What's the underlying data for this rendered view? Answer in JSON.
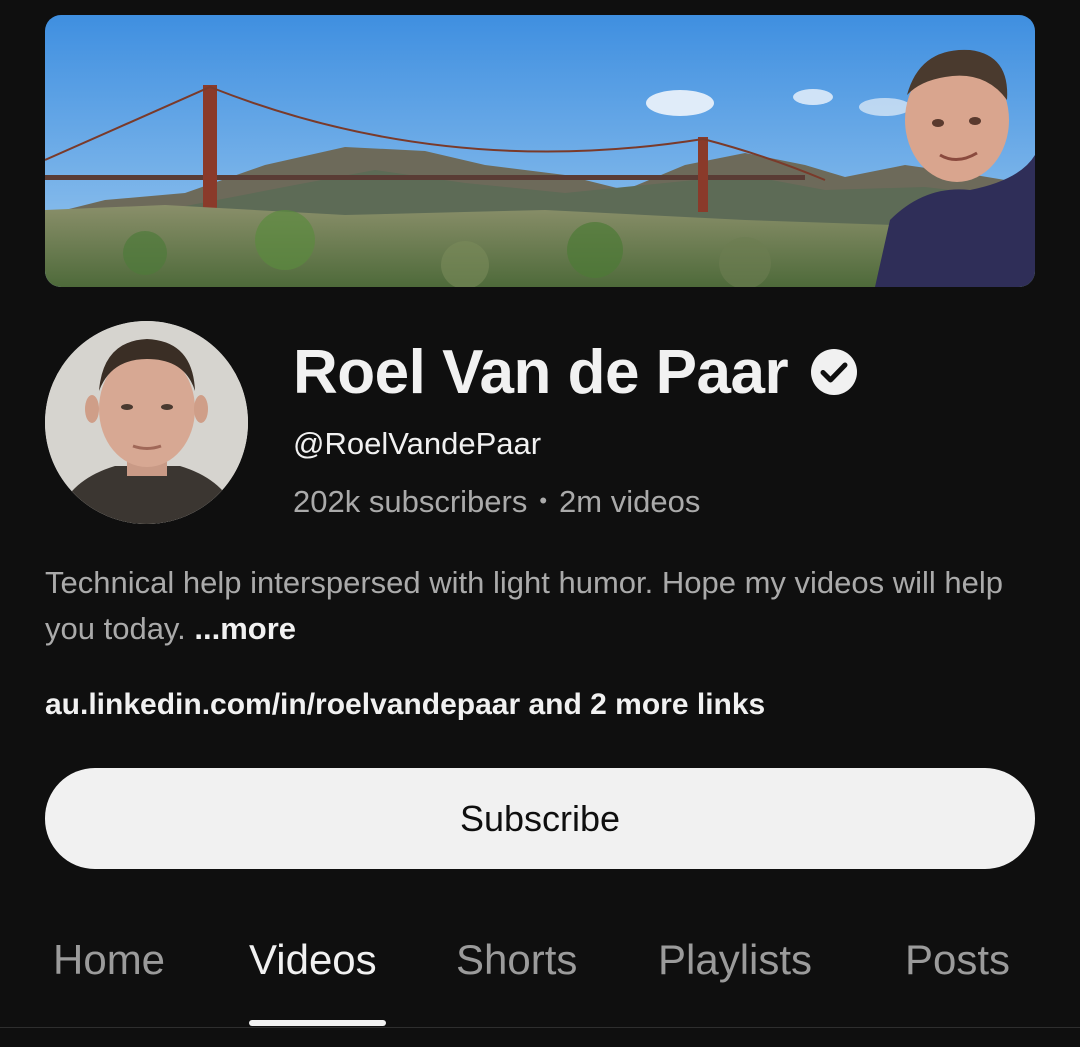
{
  "channel": {
    "name": "Roel Van de Paar",
    "handle": "@RoelVandePaar",
    "subscribers": "202k subscribers",
    "separator": "•",
    "videos": "2m videos",
    "verified": true
  },
  "description": {
    "text": "Technical help interspersed with light humor. Hope my videos will help you today.",
    "more_label": "...more"
  },
  "links": {
    "text": "au.linkedin.com/in/roelvandepaar and 2 more links"
  },
  "subscribe": {
    "label": "Subscribe"
  },
  "tabs": [
    {
      "label": "Home",
      "active": false
    },
    {
      "label": "Videos",
      "active": true
    },
    {
      "label": "Shorts",
      "active": false
    },
    {
      "label": "Playlists",
      "active": false
    },
    {
      "label": "Posts",
      "active": false
    }
  ],
  "icons": {
    "verified": "check-circle-icon"
  },
  "colors": {
    "background": "#0f0f0f",
    "primary_text": "#f1f1f1",
    "secondary_text": "#aaaaaa",
    "button_bg": "#f1f1f1"
  }
}
